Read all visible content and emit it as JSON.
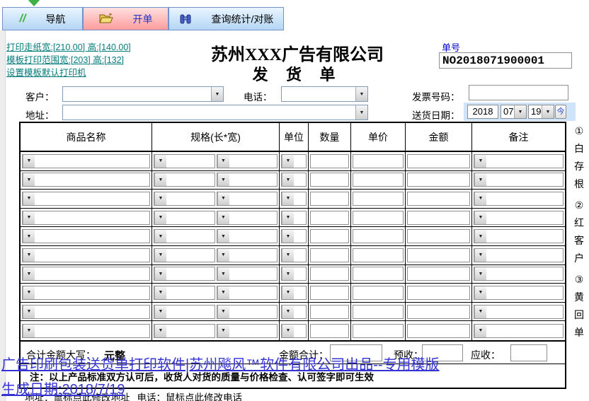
{
  "tabs": [
    {
      "label": "导航"
    },
    {
      "label": "开单"
    },
    {
      "label": "查询统计/对账"
    }
  ],
  "links": {
    "paper_size": "打印走纸宽:[210.00] 高:[140.00]",
    "template_range": "模板打印范围宽:[203] 高:[132]",
    "set_printer": "设置模板默认打印机"
  },
  "header": {
    "company": "苏州XXX广告有限公司",
    "doc_title": "发 货 单",
    "order_no_label": "单号",
    "order_no": "NO2018071900001"
  },
  "fields": {
    "customer_label": "客户：",
    "phone_label": "电话：",
    "invoice_label": "发票号码：",
    "address_label": "地址：",
    "date_label": "送货日期：",
    "date_year": "2018",
    "date_month": "07",
    "date_day": "19",
    "today_button": "今"
  },
  "table": {
    "headers": [
      "商品名称",
      "规格(长*宽)",
      "单位",
      "数量",
      "单价",
      "金额",
      "备注"
    ],
    "row_count": 10
  },
  "summary": {
    "total_caps_label": "合计金额大写：",
    "total_caps_value": "元整",
    "amount_total_label": "金额合计：",
    "prepaid_label": "预收：",
    "receivable_label": "应收："
  },
  "note": "注：以上产品标准双方认可后，收货人对货的质量与价格检查、认可签字即可生效",
  "side": {
    "chars": [
      "①",
      "白",
      "存",
      "根",
      "②",
      "红",
      "客",
      "户",
      "③",
      "黄",
      "回",
      "单"
    ]
  },
  "overlay": {
    "promo": "广告印刷包装送货单打印软件|苏州飚风™软件有限公司出品--专用模版",
    "generated": "生成日期:2018/7/19"
  },
  "footer": {
    "address": "地址：鼠标点此修改地址",
    "phone": "电话：鼠标点此修改电话"
  },
  "colors": {
    "active_tab_pink": "#fd9c9c",
    "tab_blue": "#b3d5f4",
    "link_teal": "#057c7c",
    "order_label_blue": "#0000d0",
    "date_strip_blue": "#cfe4f8",
    "overlay_blue": "#3434d4"
  }
}
